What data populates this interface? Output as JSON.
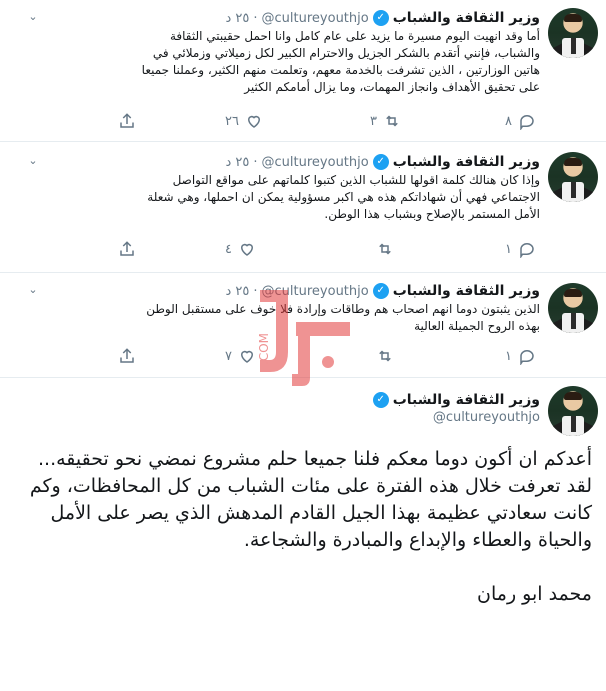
{
  "account": {
    "name": "وزير الثقافة والشباب",
    "handle": "@cultureyouthjo"
  },
  "tweets": [
    {
      "time": "٢٥ د",
      "dot": "·",
      "lines": [
        "أما وقد انهيت اليوم مسيرة ما يزيد على عام كامل وانا احمل حقيبتي الثقافة",
        "والشباب، فإنني أتقدم بالشكر الجزيل والاحترام الكبير لكل زميلاتي وزملائي في",
        "هاتين الوزارتين ، الذين تشرفت بالخدمة معهم، وتعلمت منهم الكثير، وعملنا جميعا",
        "على تحقيق الأهداف وانجاز المهمات، وما يزال أمامكم الكثير"
      ],
      "replies": "٨",
      "retweets": "٣",
      "likes": "٢٦"
    },
    {
      "time": "٢٥ د",
      "dot": "·",
      "lines": [
        "وإذا كان هنالك كلمة اقولها للشباب الذين كتبوا كلماتهم على مواقع التواصل",
        "الاجتماعي فهي أن شهاداتكم هذه هي اكبر مسؤولية يمكن ان احملها، وهي شعلة",
        "الأمل المستمر بالإصلاح وبشباب هذا الوطن."
      ],
      "replies": "١",
      "retweets": "",
      "likes": "٤"
    },
    {
      "time": "٢٥ د",
      "dot": "·",
      "lines": [
        "الذين يثبتون دوما انهم اصحاب هم وطاقات وإرادة فلا خوف على مستقبل الوطن",
        "بهذه الروح الجميلة العالية"
      ],
      "replies": "١",
      "retweets": "",
      "likes": "٧"
    }
  ],
  "main_tweet": {
    "handle": "@cultureyouthjo",
    "paragraphs": [
      "أعدكم ان أكون دوما معكم فلنا جميعا حلم مشروع نمضي نحو تحقيقه...",
      "لقد تعرفت خلال هذه الفترة على مئات الشباب من كل المحافظات، وكم كانت سعادتي عظيمة بهذا الجيل القادم المدهش الذي يصر على الأمل والحياة والعطاء والإبداع والمبادرة والشجاعة.",
      "",
      "محمد ابو رمان"
    ]
  },
  "watermark": {
    "text": ".COM",
    "color": "#e23b3b"
  },
  "colors": {
    "verified": "#1da1f2",
    "muted": "#657786",
    "divider": "#e6ecf0"
  },
  "icons": [
    "reply-icon",
    "retweet-icon",
    "like-icon",
    "share-icon",
    "verified-badge-icon",
    "chevron-down-icon"
  ]
}
